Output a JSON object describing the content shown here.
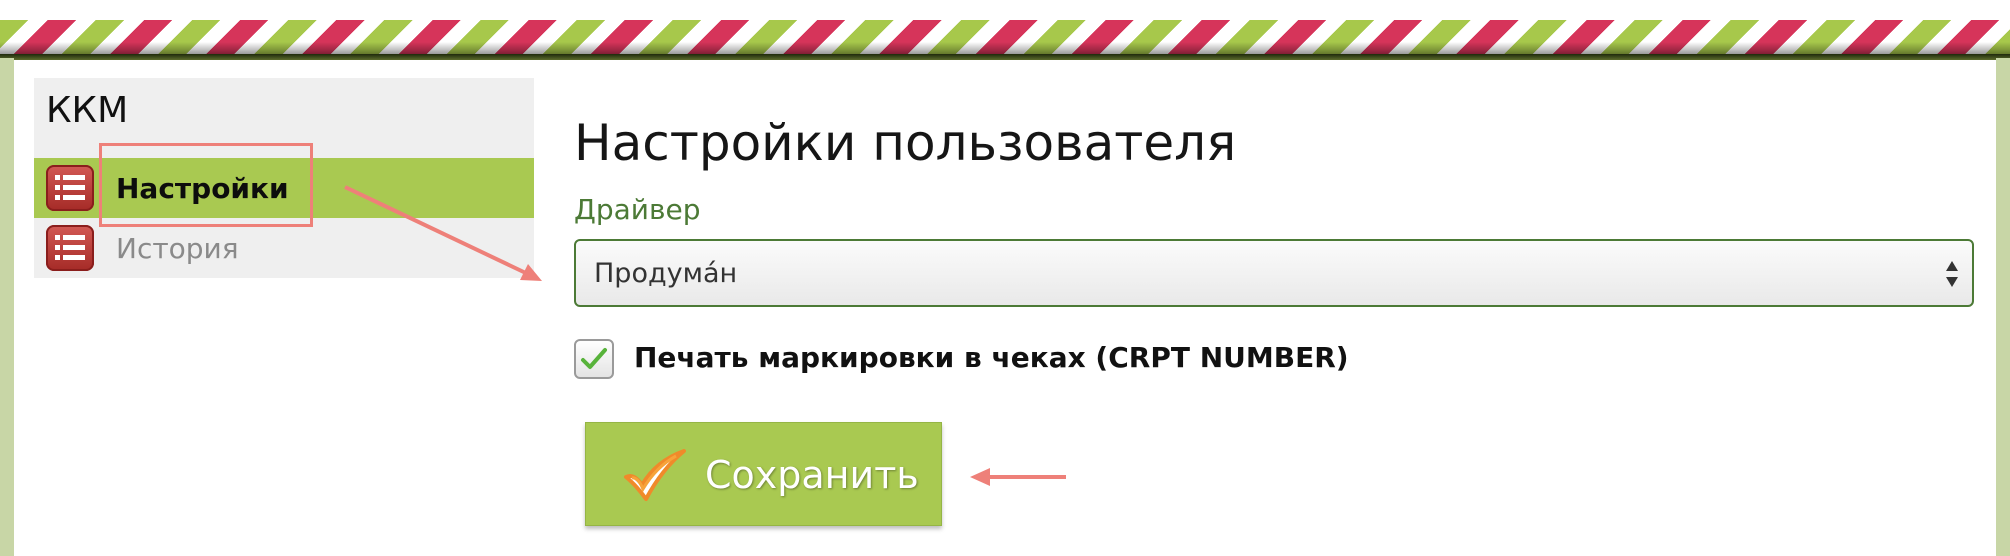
{
  "sidebar": {
    "title": "ККМ",
    "items": [
      {
        "label": "Настройки",
        "active": true,
        "icon": "list-icon"
      },
      {
        "label": "История",
        "active": false,
        "icon": "list-icon"
      }
    ]
  },
  "main": {
    "title": "Настройки пользователя",
    "driver_label": "Драйвер",
    "driver_value": "Продума́н",
    "checkbox_label": "Печать маркировки в чеках (CRPT NUMBER)",
    "checkbox_checked": true,
    "save_label": "Сохранить"
  },
  "colors": {
    "accent_green": "#a9c951",
    "label_green": "#4c7a36",
    "stripe_red": "#d6345a",
    "annotation_red": "#ee8079",
    "icon_red": "#b8342f"
  }
}
